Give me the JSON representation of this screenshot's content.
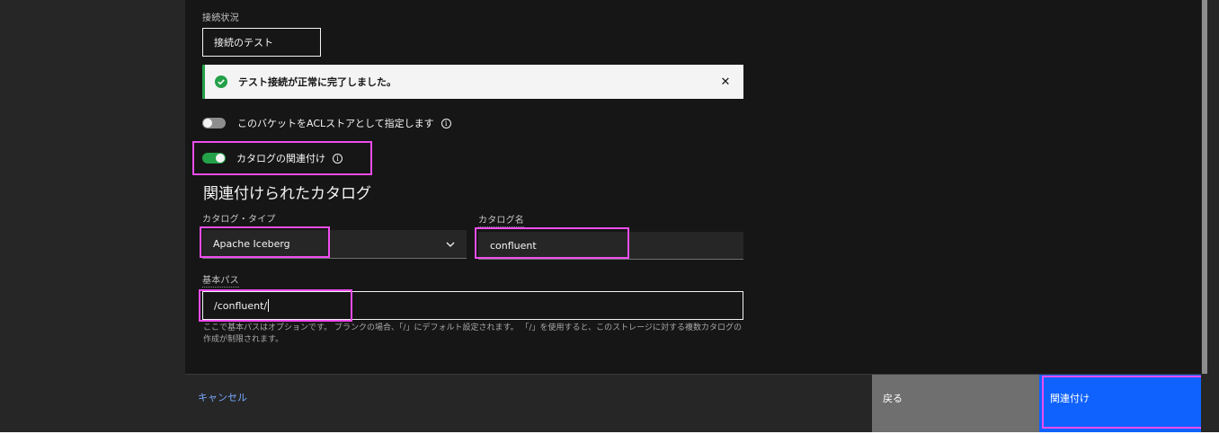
{
  "connection": {
    "status_label": "接続状況",
    "test_button_label": "接続のテスト"
  },
  "notification": {
    "message": "テスト接続が正常に完了しました。",
    "close_glyph": "✕",
    "status_color": "#24a148"
  },
  "acl_toggle": {
    "label": "このバケットをACLストアとして指定します",
    "state": "off"
  },
  "catalog_toggle": {
    "label": "カタログの関連付け",
    "state": "on"
  },
  "associated_catalog": {
    "section_title": "関連付けられたカタログ",
    "type_label": "カタログ・タイプ",
    "type_value": "Apache Iceberg",
    "name_label": "カタログ名",
    "name_value": "confluent",
    "base_path_label": "基本パス",
    "base_path_value": "/confluent/",
    "helper_text": "ここで基本パスはオプションです。 ブランクの場合、「/」にデフォルト設定されます。 「/」を使用すると、このストレージに対する複数カタログの作成が制限されます。"
  },
  "footer": {
    "cancel_label": "キャンセル",
    "back_label": "戻る",
    "associate_label": "関連付け"
  },
  "colors": {
    "highlight": "#ee4dee",
    "primary": "#0f62fe",
    "link": "#78a9ff"
  },
  "icons": {
    "success": "checkmark-filled-icon",
    "info": "information-icon",
    "dropdown": "chevron-down-icon",
    "close": "close-icon"
  }
}
